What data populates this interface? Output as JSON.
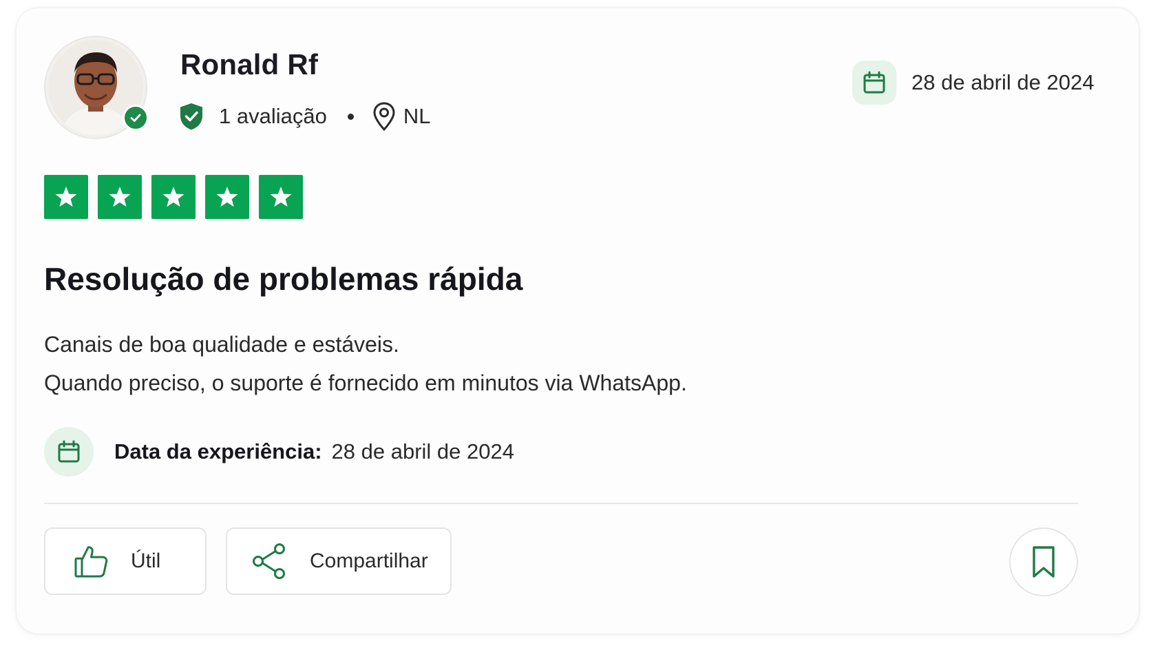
{
  "reviewer": {
    "name": "Ronald Rf",
    "review_count": "1 avaliação",
    "separator": "•",
    "country": "NL",
    "avatar_icon": "reviewer-avatar",
    "verified_icon": "verified-check-icon"
  },
  "review": {
    "date": "28 de abril de 2024",
    "rating": {
      "value": 5,
      "max": 5
    },
    "title": "Resolução de problemas rápida",
    "body": [
      "Canais de boa qualidade e estáveis.",
      "Quando preciso, o suporte é fornecido em minutos via WhatsApp."
    ],
    "experience_label": "Data da experiência:",
    "experience_date": "28 de abril de 2024"
  },
  "actions": {
    "useful_label": "Útil",
    "share_label": "Compartilhar",
    "bookmark_icon": "bookmark-icon"
  },
  "colors": {
    "brand_green": "#08a453",
    "icon_green": "#1f7a45",
    "badge_bg": "#e5f3e8",
    "text": "#1a1a1a"
  }
}
